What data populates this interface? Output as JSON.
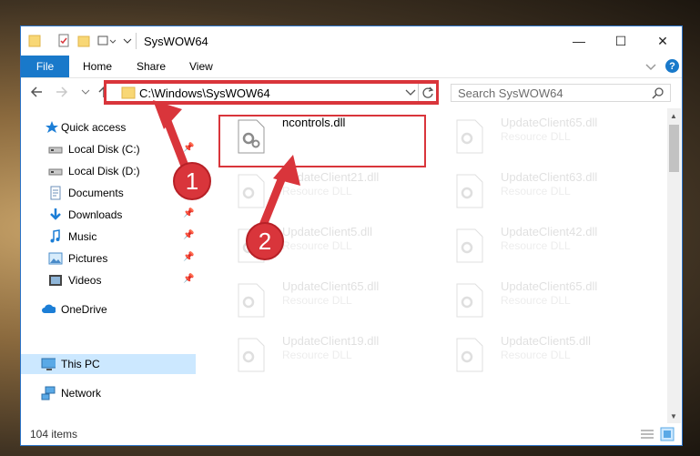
{
  "window": {
    "title": "SysWOW64",
    "controls": {
      "minimize": "—",
      "maximize": "☐",
      "close": "✕"
    }
  },
  "ribbon": {
    "tabs": [
      {
        "label": "File",
        "active": true
      },
      {
        "label": "Home"
      },
      {
        "label": "Share"
      },
      {
        "label": "View"
      }
    ],
    "expand_icon": "chevron-down-icon",
    "help_label": "?"
  },
  "address": {
    "path": "C:\\Windows\\SysWOW64",
    "search_placeholder": "Search SysWOW64"
  },
  "nav": {
    "items": [
      {
        "label": "Quick access",
        "icon": "star-icon"
      },
      {
        "label": "Local Disk (C:)",
        "icon": "drive-icon",
        "pinned": true
      },
      {
        "label": "Local Disk (D:)",
        "icon": "drive-icon",
        "pinned": true
      },
      {
        "label": "Documents",
        "icon": "documents-icon",
        "pinned": true
      },
      {
        "label": "Downloads",
        "icon": "downloads-icon",
        "pinned": true
      },
      {
        "label": "Music",
        "icon": "music-icon",
        "pinned": true
      },
      {
        "label": "Pictures",
        "icon": "pictures-icon",
        "pinned": true
      },
      {
        "label": "Videos",
        "icon": "videos-icon",
        "pinned": true
      },
      {
        "label": "OneDrive",
        "icon": "cloud-icon"
      },
      {
        "label": "This PC",
        "icon": "computer-icon",
        "selected": true
      },
      {
        "label": "Network",
        "icon": "network-icon"
      }
    ]
  },
  "files": [
    {
      "name": "ncontrols.dll",
      "desc": ""
    },
    {
      "name": "UpdateClient65.dll",
      "desc": "Resource DLL"
    },
    {
      "name": "UpdateClient21.dll",
      "desc": "Resource DLL"
    },
    {
      "name": "UpdateClient63.dll",
      "desc": "Resource DLL"
    },
    {
      "name": "UpdateClient5.dll",
      "desc": "Resource DLL"
    },
    {
      "name": "UpdateClient42.dll",
      "desc": "Resource DLL"
    },
    {
      "name": "UpdateClient65.dll",
      "desc": "Resource DLL"
    },
    {
      "name": "UpdateClient65.dll",
      "desc": "Resource DLL"
    },
    {
      "name": "UpdateClient19.dll",
      "desc": "Resource DLL"
    },
    {
      "name": "UpdateClient5.dll",
      "desc": "Resource DLL"
    }
  ],
  "status": {
    "item_count": "104 items"
  },
  "annotations": {
    "step1": "1",
    "step2": "2"
  },
  "colors": {
    "accent": "#1979ca",
    "highlight": "#d9353b",
    "selected": "#cce8ff"
  }
}
